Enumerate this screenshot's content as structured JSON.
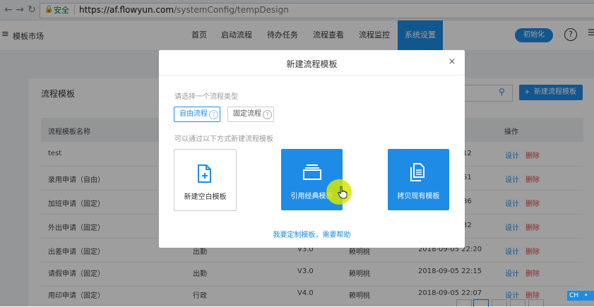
{
  "browser": {
    "back_icon": "arrow-left",
    "forward_icon": "arrow-right",
    "reload_icon": "reload",
    "security_label": "安全",
    "url_host": "https://af.flowyun.com",
    "url_path": "/systemConfig/tempDesign"
  },
  "header": {
    "menu_icon": "hamburger",
    "market_label": "模板市场",
    "nav": [
      "首页",
      "启动流程",
      "待办任务",
      "流程查看",
      "流程监控",
      "系统设置"
    ],
    "active_nav": "系统设置",
    "init_button": "初始化",
    "help_icon": "?",
    "more_icon": "menu"
  },
  "page": {
    "title": "流程模板",
    "new_button": "新建流程模板",
    "new_button_icon": "+",
    "search_icon": "search",
    "table": {
      "headers": [
        "流程模板名称",
        "操作"
      ],
      "rows": [
        {
          "name": "test",
          "category": "",
          "version": "",
          "owner": "",
          "date": "12",
          "edit": "设计",
          "delete": "删除"
        },
        {
          "name": "录用申请（自由）",
          "category": "",
          "version": "",
          "owner": "",
          "date": "51",
          "edit": "设计",
          "delete": "删除"
        },
        {
          "name": "加班申请（固定）",
          "category": "",
          "version": "",
          "owner": "",
          "date": "36",
          "edit": "设计",
          "delete": "删除"
        },
        {
          "name": "外出申请（固定）",
          "category": "",
          "version": "",
          "owner": "",
          "date": "32",
          "edit": "设计",
          "delete": "删除"
        },
        {
          "name": "出差申请（固定）",
          "category": "出勤",
          "version": "V3.0",
          "owner": "赖明桃",
          "date": "2018-09-05 22:20",
          "edit": "设计",
          "delete": "删除"
        },
        {
          "name": "请假申请（固定）",
          "category": "出勤",
          "version": "V3.0",
          "owner": "赖明桃",
          "date": "2018-09-05 22:15",
          "edit": "设计",
          "delete": "删除"
        },
        {
          "name": "用印申请（固定）",
          "category": "行政",
          "version": "V4.0",
          "owner": "赖明桃",
          "date": "2018-09-05 22:07",
          "edit": "设计",
          "delete": "删除"
        }
      ]
    }
  },
  "modal": {
    "title": "新建流程模板",
    "close_icon": "×",
    "type_prompt": "请选择一个流程类型",
    "types": [
      {
        "label": "自由流程",
        "selected": true
      },
      {
        "label": "固定流程",
        "selected": false
      }
    ],
    "help_badge": "?",
    "method_prompt": "可以通过以下方式新建流程模板",
    "tiles": [
      {
        "label": "新建空白模板",
        "icon": "new-file-icon"
      },
      {
        "label": "引用经典模板",
        "icon": "folder-icon"
      },
      {
        "label": "拷贝现有模板",
        "icon": "copy-document-icon"
      }
    ],
    "help_link": "我要定制模板，需要帮助"
  },
  "ime": {
    "lang": "CH",
    "icon": "ime-indicator"
  },
  "colors": {
    "accent": "#1e8ce6",
    "danger": "#e64545",
    "highlight": "#d6e800"
  }
}
